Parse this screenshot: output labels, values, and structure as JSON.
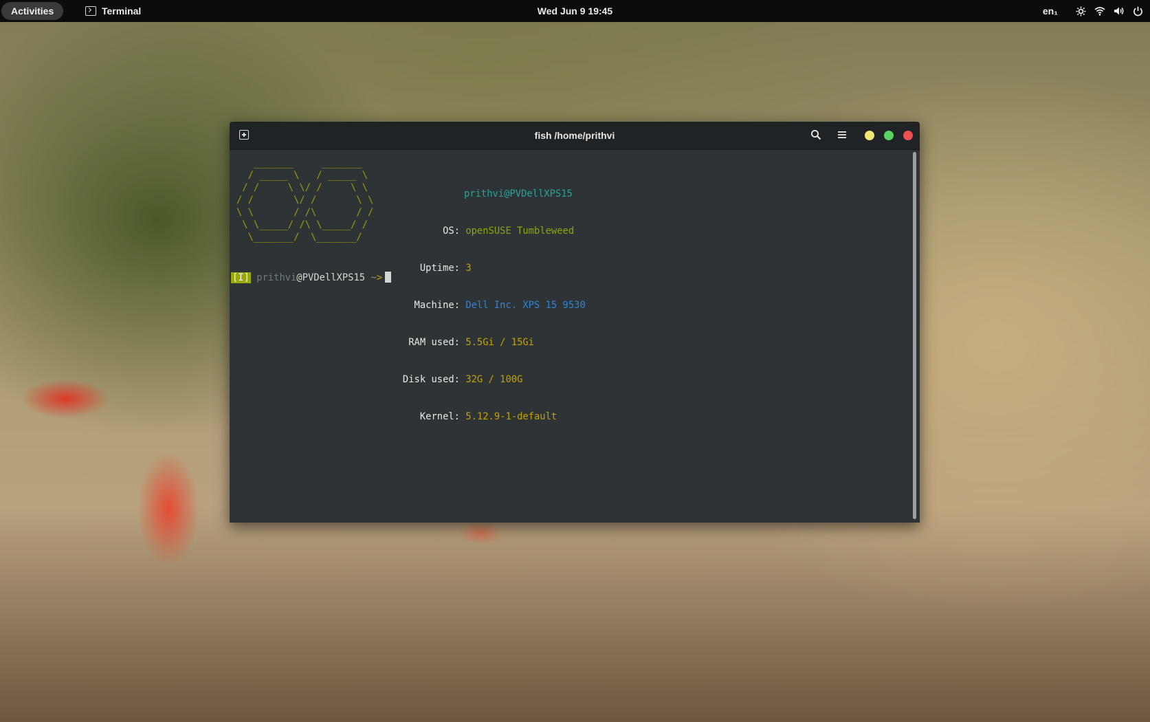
{
  "topbar": {
    "activities": "Activities",
    "app_name": "Terminal",
    "clock": "Wed Jun 9  19:45",
    "language": "en₁",
    "tray_icons": [
      "brightness-icon",
      "wifi-icon",
      "volume-icon",
      "power-icon"
    ]
  },
  "window": {
    "title": "fish /home/prithvi",
    "buttons": [
      "new-tab-icon",
      "search-icon",
      "menu-icon",
      "minimize",
      "maximize",
      "close"
    ]
  },
  "neofetch": {
    "logo": "   _______     _______\n  / _____ \\   / _____ \\\n / /     \\ \\/ /     \\ \\\n/ /       \\/ /       \\ \\\n\\ \\       / /\\       / /\n \\ \\_____/ /\\ \\_____/ /\n  \\_______/  \\_______/",
    "user_host": "prithvi@PVDellXPS15",
    "rows": [
      {
        "label": "OS:",
        "value": "openSUSE Tumbleweed"
      },
      {
        "label": "Uptime:",
        "value": "3"
      },
      {
        "label": "Machine:",
        "value": "Dell Inc. XPS 15 9530"
      },
      {
        "label": "RAM used:",
        "value": "5.5Gi / 15Gi"
      },
      {
        "label": "Disk used:",
        "value": "32G / 100G"
      },
      {
        "label": "Kernel:",
        "value": "5.12.9-1-default"
      }
    ]
  },
  "prompt": {
    "mode": "[I]",
    "user": "prithvi",
    "host": "@PVDellXPS15",
    "cwd": "~",
    "arrow": ">"
  },
  "colors": {
    "terminal_bg": "#2e3436",
    "headerbar_bg": "#1f2325",
    "logo": "#9a9e0a",
    "value_yellow": "#c4a000",
    "value_green": "#8da40f",
    "value_blue": "#2f84d4",
    "user_host": "#2aa198"
  }
}
